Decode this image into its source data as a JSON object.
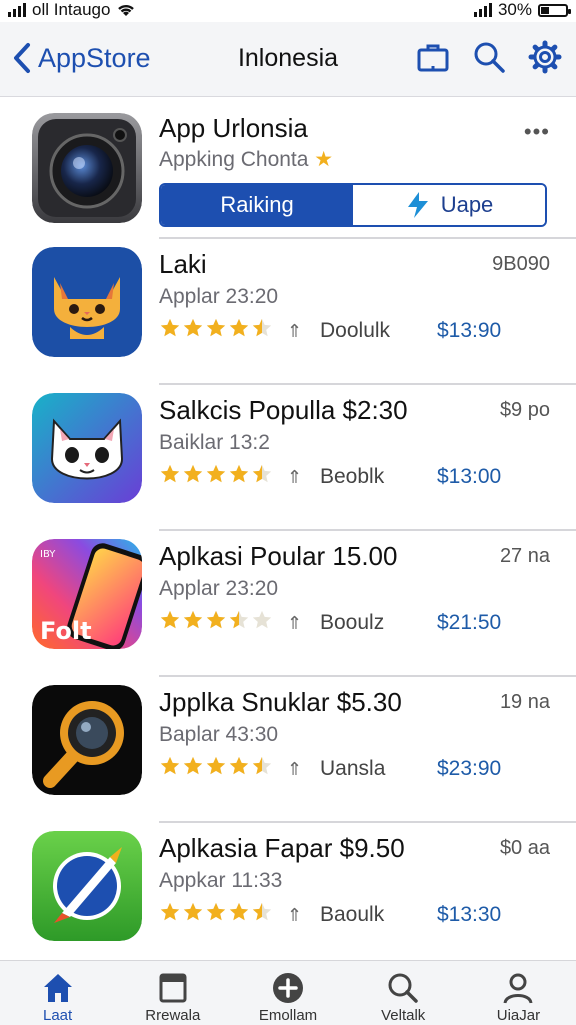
{
  "status": {
    "carrier": "oll Intaugo",
    "battery": "30%",
    "battery_level": 0.3
  },
  "nav": {
    "back_label": "AppStore",
    "title": "Inlonesia"
  },
  "featured": {
    "name": "App Urlonsia",
    "subtitle": "Appking Chonta",
    "more": "•••",
    "seg_left": "Raiking",
    "seg_right": "Uape"
  },
  "apps": [
    {
      "name": "Laki",
      "extra": "9B090",
      "sub": "Applar 23:20",
      "rating": 4.5,
      "download": "Doolulk",
      "price": "$13:90",
      "icon": "cat-orange"
    },
    {
      "name": "Salkcis Populla $2:30",
      "extra": "$9 po",
      "sub": "Baiklar 13:2",
      "rating": 4.5,
      "download": "Beoblk",
      "price": "$13:00",
      "icon": "cat-white"
    },
    {
      "name": "Aplkasi Poular 15.00",
      "extra": "27 na",
      "sub": "Applar 23:20",
      "rating": 3.5,
      "download": "Booulz",
      "price": "$21:50",
      "icon": "folt",
      "icon_label": "Folt",
      "icon_corner": "IBY"
    },
    {
      "name": "Jpplka Snuklar $5.30",
      "extra": "19 na",
      "sub": "Baplar 43:30",
      "rating": 4.5,
      "download": "Uansla",
      "price": "$23:90",
      "icon": "magnifier"
    },
    {
      "name": "Aplkasia Fapar $9.50",
      "extra": "$0 aa",
      "sub": "Appkar 11:33",
      "rating": 4.5,
      "download": "Baoulk",
      "price": "$13:30",
      "icon": "rocket"
    }
  ],
  "tabs": [
    {
      "label": "Laat",
      "icon": "home-icon",
      "active": true
    },
    {
      "label": "Rrewala",
      "icon": "window-icon",
      "active": false
    },
    {
      "label": "Emollam",
      "icon": "plus-circle-icon",
      "active": false
    },
    {
      "label": "Veltalk",
      "icon": "search-icon",
      "active": false
    },
    {
      "label": "UiaJar",
      "icon": "person-icon",
      "active": false
    }
  ],
  "colors": {
    "accent": "#1d4fb0",
    "price": "#1e5ba8",
    "star": "#f2b01e"
  }
}
